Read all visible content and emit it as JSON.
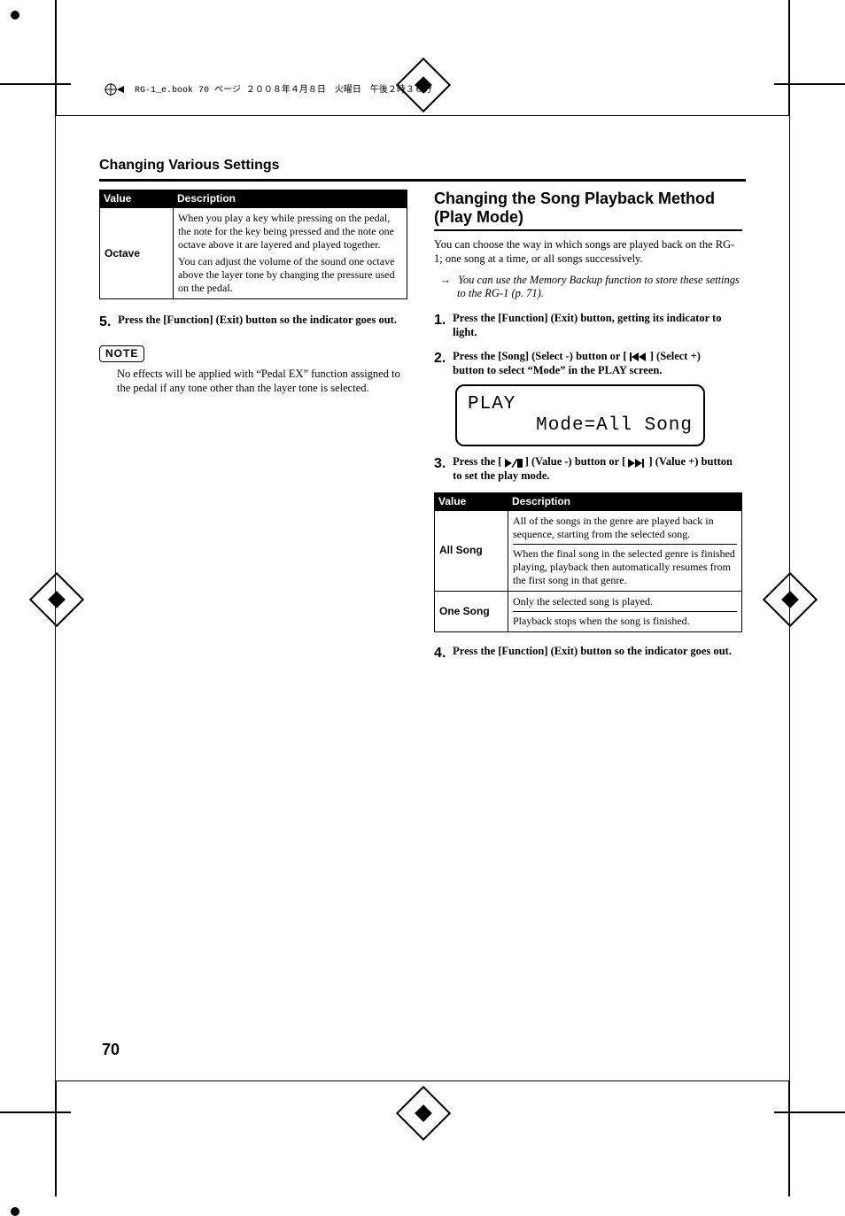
{
  "runner": "RG-1_e.book  70 ページ  ２００８年４月８日　火曜日　午後２時３６分",
  "header": {
    "title": "Changing Various Settings"
  },
  "page_num": "70",
  "left": {
    "table": {
      "th1": "Value",
      "th2": "Description",
      "row_label": "Octave",
      "row_body_a": "When you play a key while pressing on the pedal, the note for the key being pressed and the note one octave above it are layered and played together.",
      "row_body_b": "You can adjust the volume of the sound one octave above the layer tone by changing the pressure used on the pedal."
    },
    "step5_num": "5.",
    "step5_txt": "Press the [Function] (Exit) button so the indicator goes out.",
    "note_label": "NOTE",
    "note_body": "No effects will be applied with “Pedal EX” function assigned to the pedal if any tone other than the layer tone is selected."
  },
  "right": {
    "section_title": "Changing the Song Playback Method (Play Mode)",
    "intro": "You can choose the way in which songs are played back on the RG-1; one song at a time, or all songs successively.",
    "ref": "You can use the Memory Backup function to store these settings to the RG-1 (p. 71).",
    "step1_num": "1.",
    "step1_txt": "Press the [Function] (Exit) button, getting its indicator to light.",
    "step2_num": "2.",
    "step2_txt_a": "Press the [Song] (Select -) button or [ ",
    "step2_txt_b": " ] (Select +) button to select “Mode” in the PLAY screen.",
    "lcd_l1": "PLAY",
    "lcd_l2": "Mode=All Song",
    "step3_num": "3.",
    "step3_txt_a": "Press the [ ",
    "step3_txt_b": " ] (Value -) button or [ ",
    "step3_txt_c": " ] (Value +) button to set the play mode.",
    "table": {
      "th1": "Value",
      "th2": "Description",
      "row1_label": "All Song",
      "row1_a": "All of the songs in the genre are played back in sequence, starting from the selected song.",
      "row1_b": "When the final song in the selected genre is finished playing, playback then automatically resumes from the first song in that genre.",
      "row2_label": "One Song",
      "row2_a": "Only the selected song is played.",
      "row2_b": "Playback stops when the song is finished."
    },
    "step4_num": "4.",
    "step4_txt": "Press the [Function] (Exit) button so the indicator goes out."
  }
}
